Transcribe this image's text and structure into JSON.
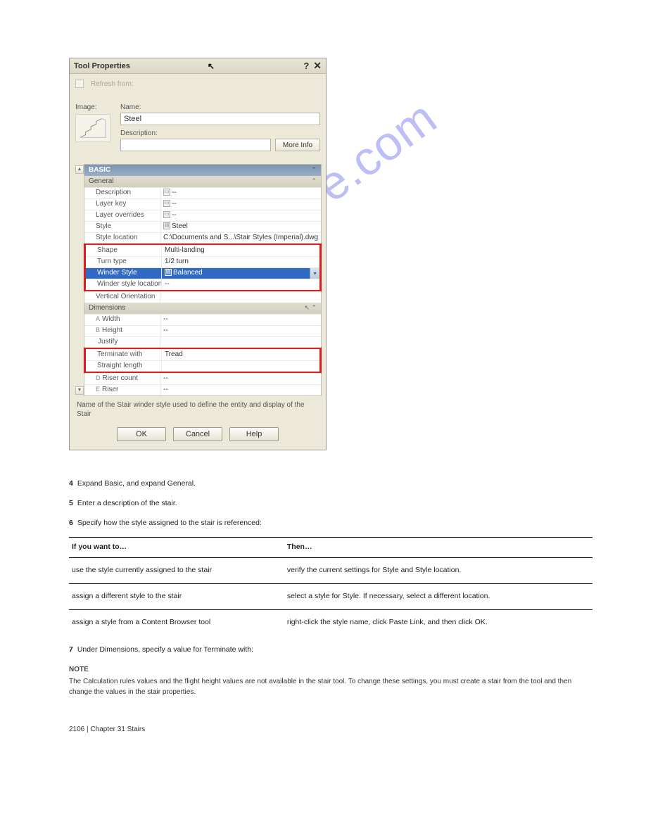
{
  "dialog": {
    "title": "Tool Properties",
    "refresh_label": "Refresh from:",
    "image_label": "Image:",
    "name_label": "Name:",
    "name_value": "Steel",
    "desc_label": "Description:",
    "more_info": "More Info",
    "basic_hdr": "BASIC",
    "general_hdr": "General",
    "rows_general": [
      {
        "label": "Description",
        "value": "--",
        "icon": true
      },
      {
        "label": "Layer key",
        "value": "--",
        "icon": true
      },
      {
        "label": "Layer overrides",
        "value": "--",
        "icon": true
      },
      {
        "label": "Style",
        "value": "Steel",
        "icon": true
      },
      {
        "label": "Style location",
        "value": "C:\\Documents and S...\\Stair Styles (Imperial).dwg"
      }
    ],
    "rows_shape": [
      {
        "label": "Shape",
        "value": "Multi-landing"
      },
      {
        "label": "Turn type",
        "value": "1/2 turn"
      },
      {
        "label": "Winder Style",
        "value": "Balanced",
        "selected": true
      },
      {
        "label": "Winder style location",
        "value": "--"
      }
    ],
    "vertical_orientation": {
      "label": "Vertical Orientation",
      "value": ""
    },
    "dimensions_hdr": "Dimensions",
    "rows_dim1": [
      {
        "pre": "A",
        "label": "Width",
        "value": "--"
      },
      {
        "pre": "B",
        "label": "Height",
        "value": "--"
      },
      {
        "pre": "",
        "label": "Justify",
        "value": ""
      }
    ],
    "rows_term": [
      {
        "label": "Terminate with",
        "value": "Tread"
      },
      {
        "label": "Straight length",
        "value": ""
      }
    ],
    "rows_dim2": [
      {
        "pre": "D",
        "label": "Riser count",
        "value": "--"
      },
      {
        "pre": "E",
        "label": "Riser",
        "value": "--"
      }
    ],
    "help_text": "Name of the Stair winder style used to define the entity and display of the Stair",
    "ok": "OK",
    "cancel": "Cancel",
    "help": "Help"
  },
  "watermark": "manualshive.com",
  "body": {
    "p1_num": "4",
    "p1": "Expand Basic, and expand General.",
    "p2_num": "5",
    "p2": "Enter a description of the stair.",
    "p3_num": "6",
    "p3": "Specify how the style assigned to the stair is referenced:",
    "table": {
      "h1": "If you want to…",
      "h2": "Then…",
      "r1c1": "use the style currently assigned to the stair",
      "r1c2": "verify the current settings for Style and Style location.",
      "r2c1": "assign a different style to the stair",
      "r2c2": "select a style for Style. If necessary, select a different location.",
      "r3c1": "assign a style from a Content Browser tool",
      "r3c2": "right-click the style name, click Paste Link, and then click OK."
    },
    "p4_num": "7",
    "p4": "Under Dimensions, specify a value for Terminate with:",
    "notice_title": "NOTE",
    "notice_body": "The Calculation rules values and the flight height values are not available in the stair tool. To change these settings, you must create a stair from the tool and then change the values in the stair properties."
  },
  "chapter": "Chapter 31   Stairs",
  "page_num": "2106"
}
